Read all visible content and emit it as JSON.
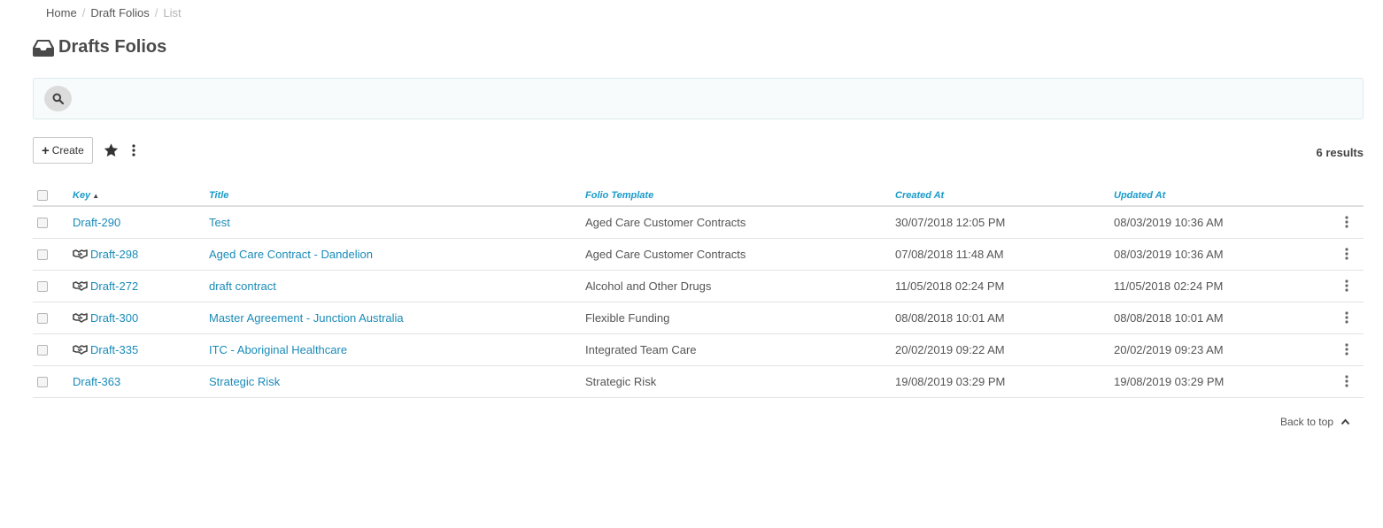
{
  "breadcrumb": {
    "items": [
      "Home",
      "Draft Folios"
    ],
    "current": "List",
    "separator": "/"
  },
  "page": {
    "title": "Drafts Folios",
    "icon": "inbox-icon"
  },
  "search": {
    "icon": "search-icon"
  },
  "toolbar": {
    "create_label": "Create",
    "favorite_icon": "star-icon",
    "more_icon": "kebab-icon"
  },
  "results": {
    "count_label": "6 results"
  },
  "table": {
    "columns": {
      "key": "Key",
      "title": "Title",
      "template": "Folio Template",
      "created": "Created At",
      "updated": "Updated At"
    },
    "sorted_column": "Key",
    "sort_direction": "ascending",
    "rows": [
      {
        "key": "Draft-290",
        "shared": false,
        "title": "Test",
        "template": "Aged Care Customer Contracts",
        "created": "30/07/2018 12:05 PM",
        "updated": "08/03/2019 10:36 AM"
      },
      {
        "key": "Draft-298",
        "shared": true,
        "title": "Aged Care Contract - Dandelion",
        "template": "Aged Care Customer Contracts",
        "created": "07/08/2018 11:48 AM",
        "updated": "08/03/2019 10:36 AM"
      },
      {
        "key": "Draft-272",
        "shared": true,
        "title": "draft contract",
        "template": "Alcohol and Other Drugs",
        "created": "11/05/2018 02:24 PM",
        "updated": "11/05/2018 02:24 PM"
      },
      {
        "key": "Draft-300",
        "shared": true,
        "title": "Master Agreement - Junction Australia",
        "template": "Flexible Funding",
        "created": "08/08/2018 10:01 AM",
        "updated": "08/08/2018 10:01 AM"
      },
      {
        "key": "Draft-335",
        "shared": true,
        "title": "ITC - Aboriginal Healthcare",
        "template": "Integrated Team Care",
        "created": "20/02/2019 09:22 AM",
        "updated": "20/02/2019 09:23 AM"
      },
      {
        "key": "Draft-363",
        "shared": false,
        "title": "Strategic Risk",
        "template": "Strategic Risk",
        "created": "19/08/2019 03:29 PM",
        "updated": "19/08/2019 03:29 PM"
      }
    ]
  },
  "footer": {
    "back_to_top": "Back to top"
  },
  "colors": {
    "link": "#1a8bb8",
    "header": "#1a9bc9",
    "search_bg": "#f7fbfc"
  }
}
